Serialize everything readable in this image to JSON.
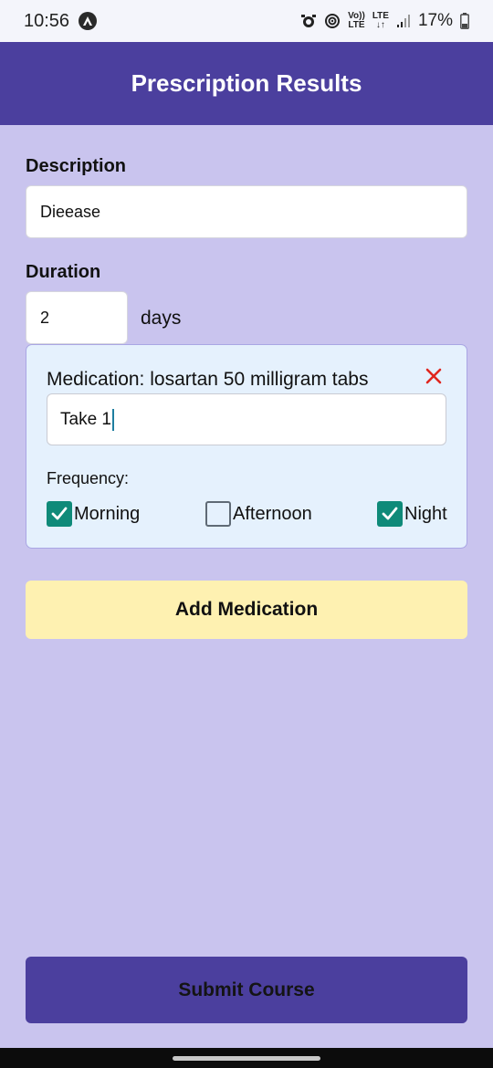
{
  "status_bar": {
    "time": "10:56",
    "lte_top": "LTE",
    "lte_bottom": "↓↑",
    "volte_top": "Vo))",
    "volte_bottom": "LTE",
    "battery": "17%"
  },
  "app_bar": {
    "title": "Prescription Results"
  },
  "form": {
    "description_label": "Description",
    "description_value": "Dieease",
    "duration_label": "Duration",
    "duration_value": "2",
    "duration_unit": "days"
  },
  "medication": {
    "title": "Medication: losartan 50 milligram tabs",
    "instruction_value": "Take 1",
    "frequency_label": "Frequency:",
    "options": [
      {
        "label": "Morning",
        "checked": true
      },
      {
        "label": "Afternoon",
        "checked": false
      },
      {
        "label": "Night",
        "checked": true
      }
    ]
  },
  "buttons": {
    "add_medication": "Add Medication",
    "submit_course": "Submit Course"
  },
  "colors": {
    "primary": "#4b3f9e",
    "background": "#c9c4ee",
    "card": "#e5f1fd",
    "checkbox_checked": "#0f8a79",
    "remove": "#e0261e",
    "add_button": "#fef1b1"
  }
}
